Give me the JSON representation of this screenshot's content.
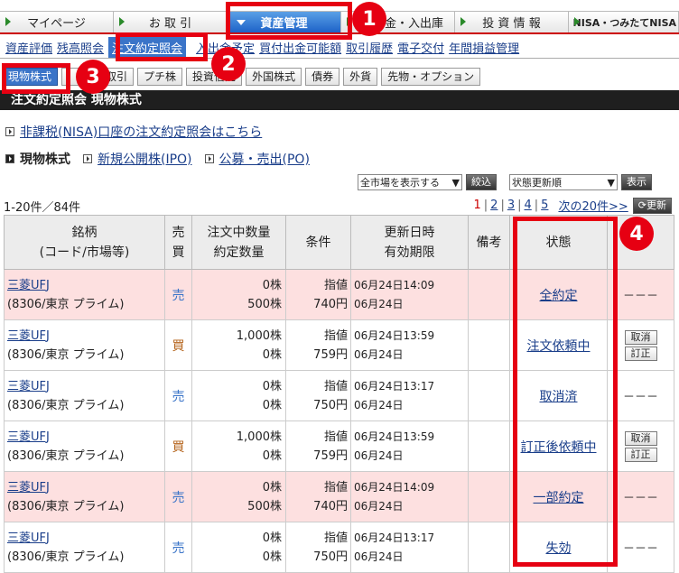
{
  "top_tabs": [
    "マイページ",
    "お 取 引",
    "資産管理",
    "金・入出庫",
    "投 資 情 報",
    "NISA・つみたてNISA"
  ],
  "sub_nav": [
    "資産評価",
    "残高照会",
    "注文約定照会",
    "入出金予定",
    "買付出金可能額",
    "取引履歴",
    "電子交付",
    "年間損益管理"
  ],
  "type_tabs": [
    "現物株式",
    "信用取引",
    "プチ株",
    "投資信託",
    "外国株式",
    "債券",
    "外貨",
    "先物・オプション"
  ],
  "page_title": "注文約定照会 現物株式",
  "nisa_link": "非課税(NISA)口座の注文約定照会はこちら",
  "section": {
    "current": "現物株式",
    "links": [
      "新規公開株(IPO)",
      "公募・売出(PO)"
    ]
  },
  "filters": {
    "market": "全市場を表示する",
    "narrow": "絞込",
    "sort": "状態更新順",
    "show": "表示"
  },
  "count_text": "1-20件／84件",
  "pagination": {
    "current": "1",
    "pages": [
      "2",
      "3",
      "4",
      "5"
    ],
    "next": "次の20件>>",
    "refresh": "更新"
  },
  "table": {
    "headers": {
      "name": "銘柄",
      "name_sub": "(コード/市場等)",
      "side": "売",
      "side_sub": "買",
      "qty": "注文中数量",
      "qty_sub": "約定数量",
      "cond": "条件",
      "date": "更新日時",
      "date_sub": "有効期限",
      "note": "備考",
      "status": "状態"
    },
    "rows": [
      {
        "name": "三菱UFJ",
        "code": "(8306/東京 プライム)",
        "side": "売",
        "q1": "0株",
        "q2": "500株",
        "cond": "指値",
        "price": "740円",
        "d1": "06月24日14:09",
        "d2": "06月24日",
        "status": "全約定",
        "ops": "－－－",
        "pink": true
      },
      {
        "name": "三菱UFJ",
        "code": "(8306/東京 プライム)",
        "side": "買",
        "q1": "1,000株",
        "q2": "0株",
        "cond": "指値",
        "price": "759円",
        "d1": "06月24日13:59",
        "d2": "06月24日",
        "status": "注文依頼中",
        "ops": "buttons",
        "pink": false
      },
      {
        "name": "三菱UFJ",
        "code": "(8306/東京 プライム)",
        "side": "売",
        "q1": "0株",
        "q2": "0株",
        "cond": "指値",
        "price": "750円",
        "d1": "06月24日13:17",
        "d2": "06月24日",
        "status": "取消済",
        "ops": "－－－",
        "pink": false
      },
      {
        "name": "三菱UFJ",
        "code": "(8306/東京 プライム)",
        "side": "買",
        "q1": "1,000株",
        "q2": "0株",
        "cond": "指値",
        "price": "759円",
        "d1": "06月24日13:59",
        "d2": "06月24日",
        "status": "訂正後依頼中",
        "ops": "buttons",
        "pink": false
      },
      {
        "name": "三菱UFJ",
        "code": "(8306/東京 プライム)",
        "side": "売",
        "q1": "0株",
        "q2": "500株",
        "cond": "指値",
        "price": "740円",
        "d1": "06月24日14:09",
        "d2": "06月24日",
        "status": "一部約定",
        "ops": "－－－",
        "pink": true
      },
      {
        "name": "三菱UFJ",
        "code": "(8306/東京 プライム)",
        "side": "売",
        "q1": "0株",
        "q2": "0株",
        "cond": "指値",
        "price": "750円",
        "d1": "06月24日13:17",
        "d2": "06月24日",
        "status": "失効",
        "ops": "－－－",
        "pink": false
      }
    ],
    "cancel_label": "取消",
    "modify_label": "訂正"
  },
  "callouts": [
    "1",
    "2",
    "3",
    "4"
  ],
  "colors": {
    "highlight": "#e60012",
    "buy": "#b5651d",
    "sell": "#3a74c8",
    "pink_row": "#fde0e0"
  }
}
